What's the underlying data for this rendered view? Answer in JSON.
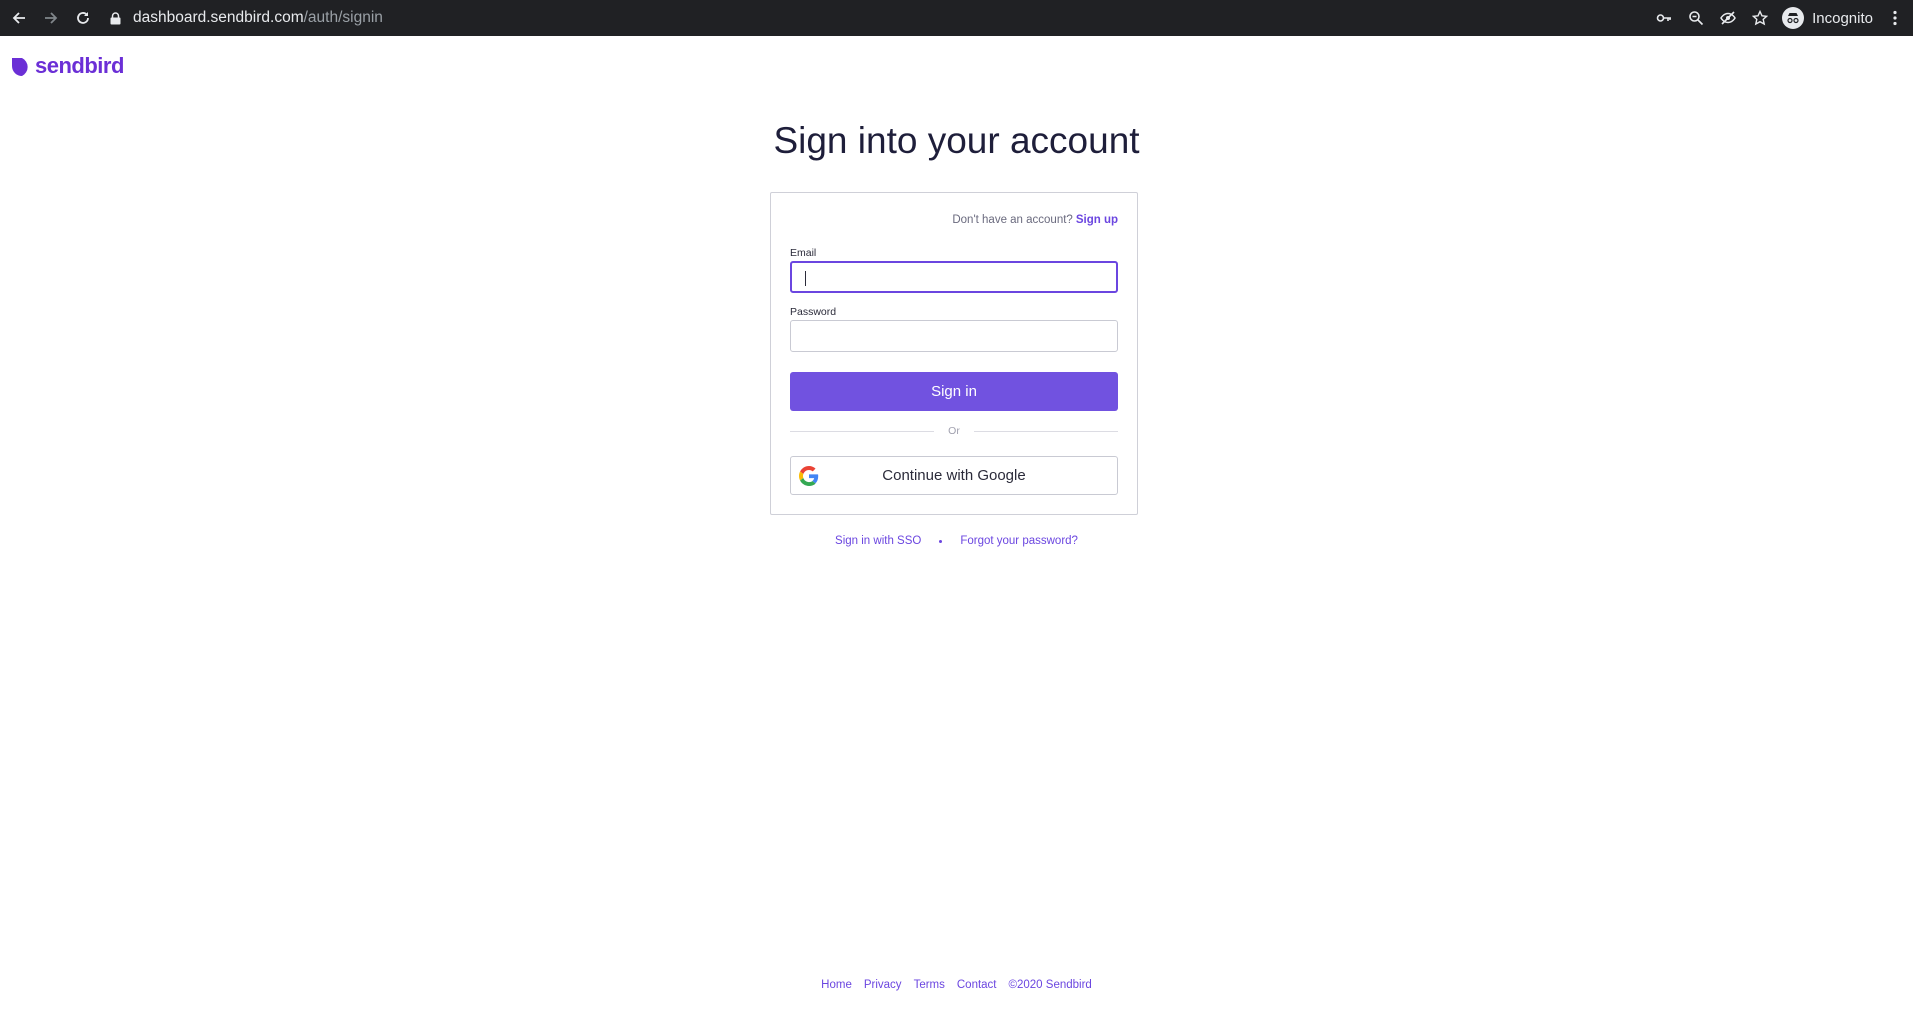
{
  "browser": {
    "url_host": "dashboard.sendbird.com",
    "url_path": "/auth/signin",
    "profile_label": "Incognito"
  },
  "brand": {
    "name": "sendbird",
    "color": "#6b2fd6"
  },
  "page": {
    "title": "Sign into your account"
  },
  "form": {
    "signup_prompt": "Don't have an account?",
    "signup_link": "Sign up",
    "email_label": "Email",
    "email_value": "",
    "password_label": "Password",
    "password_value": "",
    "signin_button": "Sign in",
    "divider_text": "Or",
    "google_button": "Continue with Google",
    "accent_color": "#7152e0"
  },
  "links": {
    "sso": "Sign in with SSO",
    "forgot": "Forgot your password?"
  },
  "footer": {
    "items": [
      "Home",
      "Privacy",
      "Terms",
      "Contact"
    ],
    "copyright": "©2020 Sendbird"
  },
  "icons": {
    "back": "arrow-left-icon",
    "forward": "arrow-right-icon",
    "reload": "reload-icon",
    "lock": "lock-icon",
    "key": "key-icon",
    "zoom": "magnifier-icon",
    "tracking": "eye-slash-icon",
    "bookmark": "star-icon",
    "incognito": "incognito-icon",
    "menu": "kebab-menu-icon",
    "google": "google-g-icon"
  }
}
